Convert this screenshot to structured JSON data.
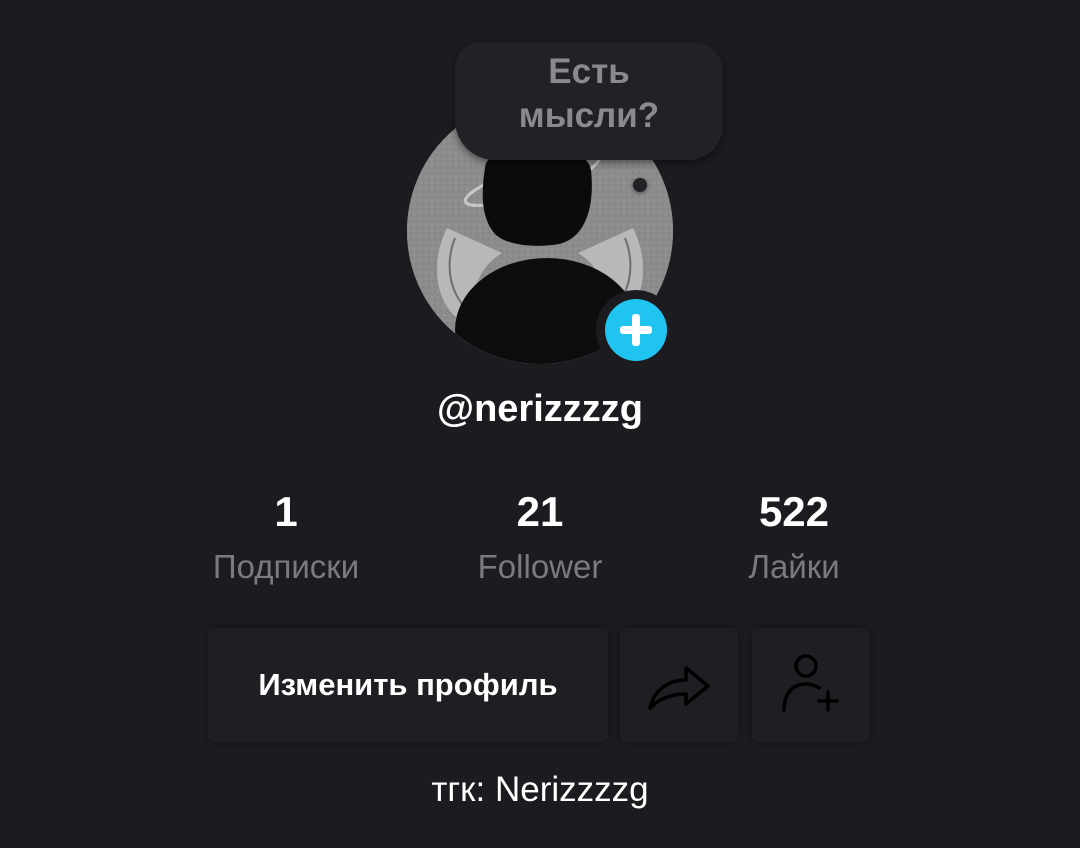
{
  "profile": {
    "note_prompt": "Есть\nмысли?",
    "username": "@nerizzzzg",
    "bio": "тгк: Nerizzzzg"
  },
  "stats": {
    "following": {
      "value": "1",
      "label": "Подписки"
    },
    "followers": {
      "value": "21",
      "label": "Follower"
    },
    "likes": {
      "value": "522",
      "label": "Лайки"
    }
  },
  "actions": {
    "edit_profile_label": "Изменить профиль",
    "share_icon": "share-arrow-icon",
    "add_friend_icon": "add-user-icon"
  },
  "colors": {
    "background": "#1c1b1f",
    "accent": "#20c4f0",
    "secondary_text": "#7b7a7f"
  }
}
